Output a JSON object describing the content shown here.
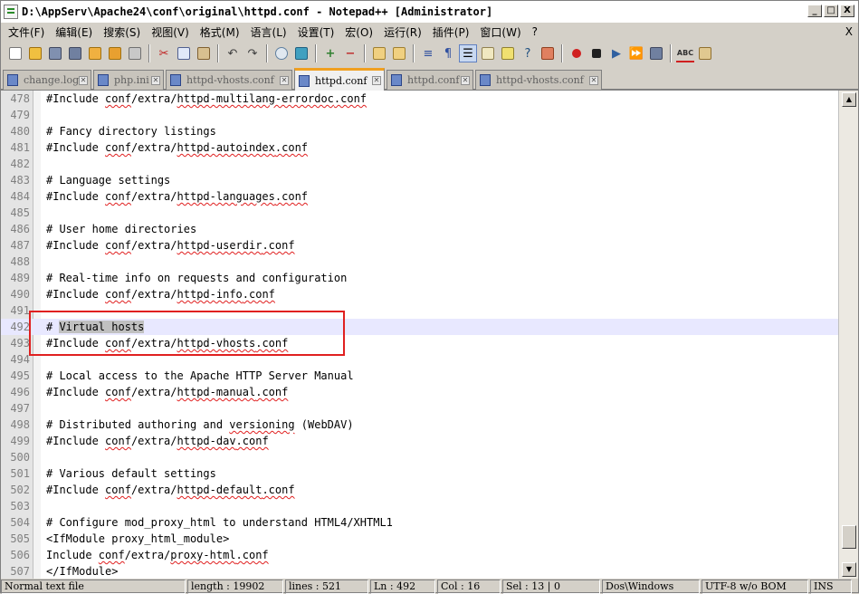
{
  "window": {
    "title": "D:\\AppServ\\Apache24\\conf\\original\\httpd.conf - Notepad++ [Administrator]",
    "min_label": "_",
    "max_label": "□",
    "close_label": "X"
  },
  "menu": {
    "items": [
      "文件(F)",
      "编辑(E)",
      "搜索(S)",
      "视图(V)",
      "格式(M)",
      "语言(L)",
      "设置(T)",
      "宏(O)",
      "运行(R)",
      "插件(P)",
      "窗口(W)",
      "?"
    ],
    "close_label": "X"
  },
  "toolbar": {
    "icons": [
      "new-file-icon",
      "open-file-icon",
      "save-icon",
      "save-all-icon",
      "close-icon",
      "close-all-icon",
      "print-icon",
      "cut-icon",
      "copy-icon",
      "paste-icon",
      "undo-icon",
      "redo-icon",
      "find-icon",
      "replace-icon",
      "zoom-in-icon",
      "zoom-out-icon",
      "sync-vertical-icon",
      "sync-horizontal-icon",
      "word-wrap-icon",
      "show-all-chars-icon",
      "indent-guide-icon",
      "doc-map-icon",
      "function-list-icon",
      "folder-workspace-icon",
      "record-macro-icon",
      "stop-record-icon",
      "play-macro-icon",
      "run-macro-multiple-icon",
      "save-macro-icon",
      "spellcheck-icon",
      "plugin-icon"
    ]
  },
  "tabs": [
    {
      "label": "change.log",
      "active": false
    },
    {
      "label": "php.ini",
      "active": false
    },
    {
      "label": "httpd-vhosts.conf",
      "active": false
    },
    {
      "label": "httpd.conf",
      "active": true
    },
    {
      "label": "httpd.conf",
      "active": false
    },
    {
      "label": "httpd-vhosts.conf",
      "active": false
    }
  ],
  "editor": {
    "lines": [
      {
        "n": "478",
        "text": "#Include conf/extra/httpd-multilang-errordoc.conf"
      },
      {
        "n": "479",
        "text": ""
      },
      {
        "n": "480",
        "text": "# Fancy directory listings"
      },
      {
        "n": "481",
        "text": "#Include conf/extra/httpd-autoindex.conf"
      },
      {
        "n": "482",
        "text": ""
      },
      {
        "n": "483",
        "text": "# Language settings"
      },
      {
        "n": "484",
        "text": "#Include conf/extra/httpd-languages.conf"
      },
      {
        "n": "485",
        "text": ""
      },
      {
        "n": "486",
        "text": "# User home directories"
      },
      {
        "n": "487",
        "text": "#Include conf/extra/httpd-userdir.conf"
      },
      {
        "n": "488",
        "text": ""
      },
      {
        "n": "489",
        "text": "# Real-time info on requests and configuration"
      },
      {
        "n": "490",
        "text": "#Include conf/extra/httpd-info.conf"
      },
      {
        "n": "491",
        "text": ""
      },
      {
        "n": "492",
        "text": "# Virtual hosts"
      },
      {
        "n": "493",
        "text": "#Include conf/extra/httpd-vhosts.conf"
      },
      {
        "n": "494",
        "text": ""
      },
      {
        "n": "495",
        "text": "# Local access to the Apache HTTP Server Manual"
      },
      {
        "n": "496",
        "text": "#Include conf/extra/httpd-manual.conf"
      },
      {
        "n": "497",
        "text": ""
      },
      {
        "n": "498",
        "text": "# Distributed authoring and versioning (WebDAV)"
      },
      {
        "n": "499",
        "text": "#Include conf/extra/httpd-dav.conf"
      },
      {
        "n": "500",
        "text": ""
      },
      {
        "n": "501",
        "text": "# Various default settings"
      },
      {
        "n": "502",
        "text": "#Include conf/extra/httpd-default.conf"
      },
      {
        "n": "503",
        "text": ""
      },
      {
        "n": "504",
        "text": "# Configure mod_proxy_html to understand HTML4/XHTML1"
      },
      {
        "n": "505",
        "text": "<IfModule proxy_html_module>"
      },
      {
        "n": "506",
        "text": "Include conf/extra/proxy-html.conf"
      },
      {
        "n": "507",
        "text": "</IfModule>"
      }
    ],
    "current_line": "492",
    "selected_text": "Virtual hosts"
  },
  "status": {
    "file_type": "Normal text file",
    "length": "length : 19902",
    "lines": "lines : 521",
    "ln": "Ln : 492",
    "col": "Col : 16",
    "sel": "Sel : 13 | 0",
    "eol": "Dos\\Windows",
    "encoding": "UTF-8 w/o BOM",
    "mode": "INS"
  },
  "colors": {
    "current_line_bg": "#e8e8ff",
    "annotation_box": "#e02020",
    "active_tab_accent": "#f0a020"
  }
}
